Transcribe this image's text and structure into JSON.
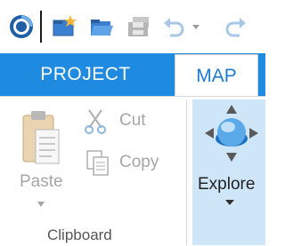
{
  "quick_access": {
    "items": [
      {
        "icon": "app-logo-icon"
      },
      {
        "icon": "new-project-icon"
      },
      {
        "icon": "open-project-icon"
      },
      {
        "icon": "save-project-icon"
      },
      {
        "icon": "undo-icon"
      },
      {
        "icon": "undo-dropdown-icon"
      },
      {
        "icon": "redo-icon"
      }
    ]
  },
  "tabs": {
    "project": "PROJECT",
    "map": "MAP"
  },
  "clipboard": {
    "paste": "Paste",
    "cut": "Cut",
    "copy": "Copy",
    "group_label": "Clipboard"
  },
  "navigate": {
    "explore": "Explore"
  },
  "colors": {
    "accent": "#1e8be0",
    "selected_tab_text": "#1f7bd1",
    "explore_bg": "#cfe5f8"
  }
}
